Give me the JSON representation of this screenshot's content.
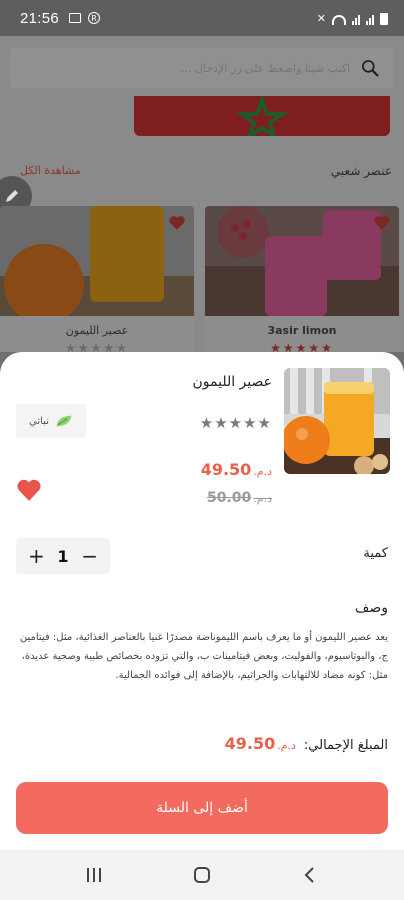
{
  "status_bar": {
    "time": "21:56",
    "r_badge": "R"
  },
  "background": {
    "search_placeholder": "اكتب شيئا واضغط على زر الإدخال ...",
    "section_title": "عنصر شعبي",
    "see_all": "مشاهدة الكل",
    "cards": [
      {
        "name": "3asir limon",
        "stars": "★★★★★"
      },
      {
        "name": "عصير الليمون",
        "stars": "★★★★★"
      }
    ]
  },
  "product": {
    "title": "عصير الليمون",
    "stars": "★★★★★",
    "badge_label": "نباتي",
    "currency": "د.م.",
    "price": "49.50",
    "old_price": "50.00",
    "quantity_label": "كمية",
    "quantity": "1",
    "plus": "+",
    "minus": "−",
    "description_title": "وصف",
    "description": "يعد عصير الليمون أو ما يعرف باسم الليموناضة مصدرًا غنيا بالعناصر الغذائية، مثل: فيتامين ج، والبوتاسيوم، والفوليت، وبعض فيتامينات ب، والتي تزوده بخصائص طبية وصحية عديدة، مثل: كونه مضاد للالتهابات والجراثيم، بالإضافة إلى فوائده الجمالية.",
    "total_label": "المبلغ الإجمالي:",
    "total_price": "49.50",
    "add_button": "أضف إلى السلة"
  },
  "colors": {
    "accent": "#f26b5e",
    "price": "#e8614b"
  },
  "icons": [
    "search-icon",
    "pencil-icon",
    "heart-icon",
    "leaf-icon",
    "recents-icon",
    "home-icon",
    "back-icon"
  ]
}
